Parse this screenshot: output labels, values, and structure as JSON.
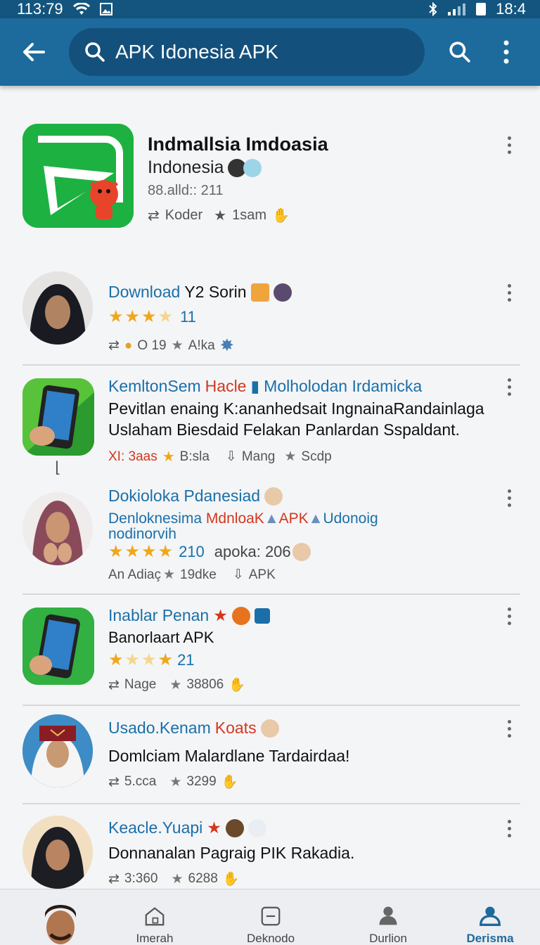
{
  "status_bar": {
    "time": "113:79",
    "time_right": "18:4"
  },
  "search": {
    "value": "APK Idonesia APK"
  },
  "featured": {
    "title": "Indmallsia Imdoasia",
    "subtitle": "Indonesia",
    "meta": "88.alld:: 211",
    "stat_1": "Koder",
    "stat_2": "1sam"
  },
  "items": [
    {
      "title": "Download",
      "title_2": "Y2 Sorin",
      "rating": "11",
      "stat_1": "O 19",
      "stat_2": "A!ka"
    },
    {
      "title": "KemltonSem",
      "title_red": "Hacle",
      "title_2": "Molholodan Irdamicka",
      "line_1": "Pevitlan enaing K:ananhedsait IngnainaRandainlaga",
      "line_2": "Uslaham Biesdaid Felakan Panlardan Sspaldant.",
      "stat_1": "XI: 3aas",
      "stat_2": "B:sla",
      "stat_3": "Mang",
      "stat_4": "Scdp"
    },
    {
      "title": "Dokioloka Pdanesiad",
      "line_1a": "Denloknesima",
      "line_1b": "MdnloaK",
      "line_1c": "APK",
      "line_1d": "Udonoig",
      "line_2": "nodinorvih",
      "rating": "210",
      "rating_extra": "apoka: 206",
      "stat_1": "An Adiaç",
      "stat_2": "19dke",
      "stat_3": "APK"
    },
    {
      "title": "Inablar Penan",
      "line_1": "Banorlaart APK",
      "rating": "21",
      "stat_1": "Nage",
      "stat_2": "38806"
    },
    {
      "title": "Usado.Kenam",
      "title_red": "Koats",
      "line_1": "Domlciam Malardlane Tardairdaa!",
      "stat_1": "5.cca",
      "stat_2": "3299"
    },
    {
      "title": "Keacle.Yuapi",
      "line_1": "Donnanalan Pagraig PIK Rakadia.",
      "stat_1": "3:360",
      "stat_2": "6288"
    }
  ],
  "nav": [
    {
      "label": "Imerah"
    },
    {
      "label": "Deknodo"
    },
    {
      "label": "Durlion"
    },
    {
      "label": "Derisma"
    }
  ],
  "colors": {
    "app_bar": "#1d6a9c",
    "status_bar": "#13557e",
    "link_blue": "#1a6fa8",
    "accent_red": "#d4371e",
    "star": "#f0a719",
    "app_green": "#1db141"
  }
}
